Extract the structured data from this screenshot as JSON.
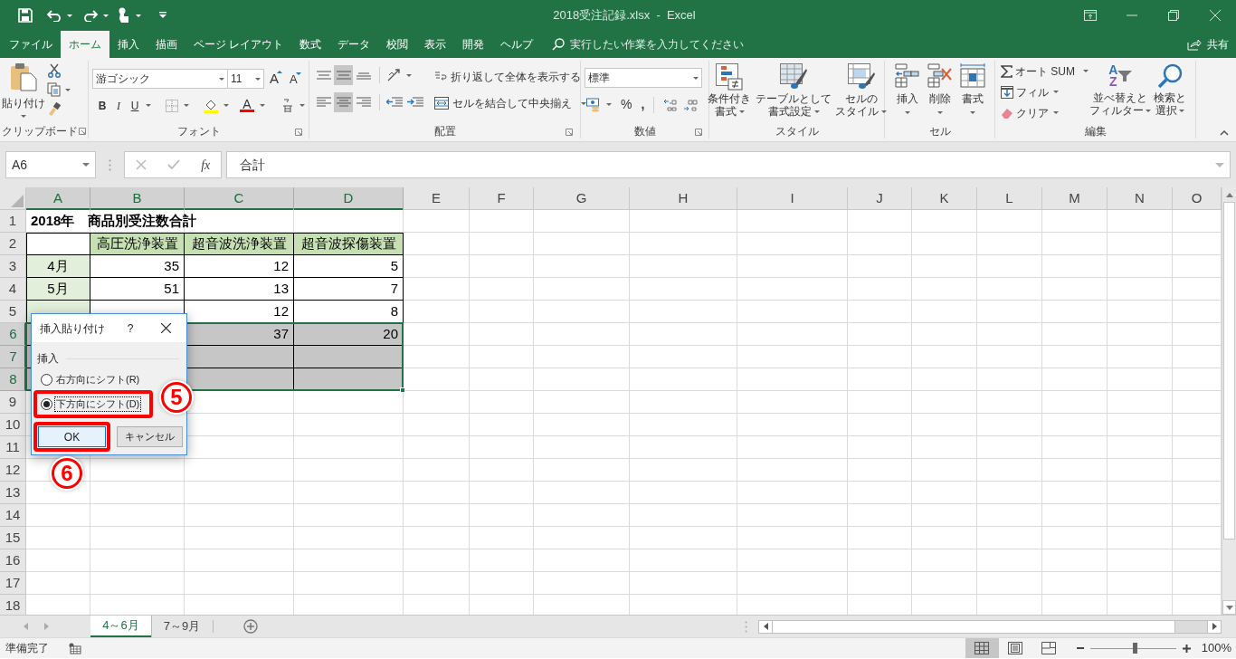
{
  "window": {
    "title": "2018受注記録.xlsx  -  Excel"
  },
  "menu_tabs": [
    {
      "label": "ファイル",
      "selected": false
    },
    {
      "label": "ホーム",
      "selected": true
    },
    {
      "label": "挿入",
      "selected": false
    },
    {
      "label": "描画",
      "selected": false
    },
    {
      "label": "ページ レイアウト",
      "selected": false
    },
    {
      "label": "数式",
      "selected": false
    },
    {
      "label": "データ",
      "selected": false
    },
    {
      "label": "校閲",
      "selected": false
    },
    {
      "label": "表示",
      "selected": false
    },
    {
      "label": "開発",
      "selected": false
    },
    {
      "label": "ヘルプ",
      "selected": false
    }
  ],
  "tell_me": {
    "placeholder": "実行したい作業を入力してください"
  },
  "share": "共有",
  "ribbon": {
    "clipboard": {
      "label": "クリップボード",
      "paste": "貼り付け"
    },
    "font": {
      "label": "フォント",
      "font_name": "游ゴシック",
      "font_size": "11",
      "grow": "A",
      "shrink": "A",
      "bold": "B",
      "italic": "I",
      "underline": "U",
      "font_color": "A"
    },
    "alignment": {
      "label": "配置",
      "wrap_text": "折り返して全体を表示する",
      "merge_center": "セルを結合して中央揃え"
    },
    "number": {
      "label": "数値",
      "format": "標準",
      "percent": "%",
      "comma": ","
    },
    "styles": {
      "label": "スタイル",
      "conditional": [
        "条件付き",
        "書式"
      ],
      "table": [
        "テーブルとして",
        "書式設定"
      ],
      "cell_styles": [
        "セルの",
        "スタイル"
      ]
    },
    "cells": {
      "label": "セル",
      "insert": "挿入",
      "delete": "削除",
      "format": "書式"
    },
    "editing": {
      "label": "編集",
      "autosum": "オート SUM",
      "fill": "フィル",
      "clear": "クリア",
      "sort_letters": [
        "A",
        "Z"
      ],
      "sort_filter": [
        "並べ替えと",
        "フィルター"
      ],
      "find_select": [
        "検索と",
        "選択"
      ]
    }
  },
  "formula_bar": {
    "name_box": "A6",
    "fx": "fx",
    "value": "合計"
  },
  "columns": [
    {
      "label": "A",
      "selected": true
    },
    {
      "label": "B",
      "selected": true
    },
    {
      "label": "C",
      "selected": true
    },
    {
      "label": "D",
      "selected": true
    },
    {
      "label": "E",
      "selected": false
    },
    {
      "label": "F",
      "selected": false
    },
    {
      "label": "G",
      "selected": false
    },
    {
      "label": "H",
      "selected": false
    },
    {
      "label": "I",
      "selected": false
    },
    {
      "label": "J",
      "selected": false
    },
    {
      "label": "K",
      "selected": false
    },
    {
      "label": "L",
      "selected": false
    },
    {
      "label": "M",
      "selected": false
    },
    {
      "label": "N",
      "selected": false
    },
    {
      "label": "O",
      "selected": false
    }
  ],
  "rows": [
    {
      "label": "1",
      "selected": false,
      "cells": [
        {
          "kind": "title",
          "text": "2018年　商品別受注数合計"
        }
      ]
    },
    {
      "label": "2",
      "selected": false,
      "cells": [
        {
          "kind": "blank"
        },
        {
          "kind": "header",
          "text": "高圧洗浄装置"
        },
        {
          "kind": "header",
          "text": "超音波洗浄装置"
        },
        {
          "kind": "header",
          "text": "超音波探傷装置"
        }
      ]
    },
    {
      "label": "3",
      "selected": false,
      "cells": [
        {
          "kind": "month",
          "text": "4月"
        },
        {
          "kind": "number",
          "text": "35"
        },
        {
          "kind": "number",
          "text": "12"
        },
        {
          "kind": "number",
          "text": "5"
        }
      ]
    },
    {
      "label": "4",
      "selected": false,
      "cells": [
        {
          "kind": "month",
          "text": "5月"
        },
        {
          "kind": "number",
          "text": "51"
        },
        {
          "kind": "number",
          "text": "13"
        },
        {
          "kind": "number",
          "text": "7"
        }
      ]
    },
    {
      "label": "5",
      "selected": false,
      "cells": [
        {
          "kind": "month"
        },
        {
          "kind": "number"
        },
        {
          "kind": "number",
          "text": "12"
        },
        {
          "kind": "number",
          "text": "8"
        }
      ]
    },
    {
      "label": "6",
      "selected": true,
      "cells": [
        {
          "kind": "blank"
        },
        null,
        {
          "kind": "number",
          "text": "37"
        },
        {
          "kind": "number",
          "text": "20"
        }
      ]
    },
    {
      "label": "7",
      "selected": true,
      "cells": [
        {
          "kind": "blank"
        },
        null,
        {
          "kind": "blank"
        },
        {
          "kind": "blank"
        }
      ]
    },
    {
      "label": "8",
      "selected": true,
      "cells": [
        {
          "kind": "blank"
        },
        null,
        {
          "kind": "blank"
        },
        {
          "kind": "blank"
        }
      ]
    },
    {
      "label": "9",
      "selected": false
    },
    {
      "label": "10",
      "selected": false
    },
    {
      "label": "11",
      "selected": false
    },
    {
      "label": "12",
      "selected": false
    },
    {
      "label": "13",
      "selected": false
    },
    {
      "label": "14",
      "selected": false
    },
    {
      "label": "15",
      "selected": false
    },
    {
      "label": "16",
      "selected": false
    },
    {
      "label": "17",
      "selected": false
    },
    {
      "label": "18",
      "selected": false
    }
  ],
  "dialog": {
    "title": "挿入貼り付け",
    "help": "?",
    "section": "挿入",
    "options": [
      {
        "label": "右方向にシフト(R)",
        "selected": false,
        "highlighted": false
      },
      {
        "label": "下方向にシフト(D)",
        "selected": true,
        "highlighted": true
      }
    ],
    "buttons": [
      {
        "label": "OK",
        "default": true,
        "highlighted": true
      },
      {
        "label": "キャンセル",
        "default": false,
        "highlighted": false
      }
    ]
  },
  "annotations": [
    {
      "number": "5"
    },
    {
      "number": "6"
    }
  ],
  "sheet_tabs": [
    {
      "label": "4～6月",
      "selected": true
    },
    {
      "label": "7～9月",
      "selected": false
    }
  ],
  "status_bar": {
    "text": "準備完了",
    "views": [
      {
        "selected": true
      },
      {
        "selected": false
      },
      {
        "selected": false
      }
    ],
    "zoom": {
      "level": 0.52,
      "reading": "100%"
    }
  }
}
